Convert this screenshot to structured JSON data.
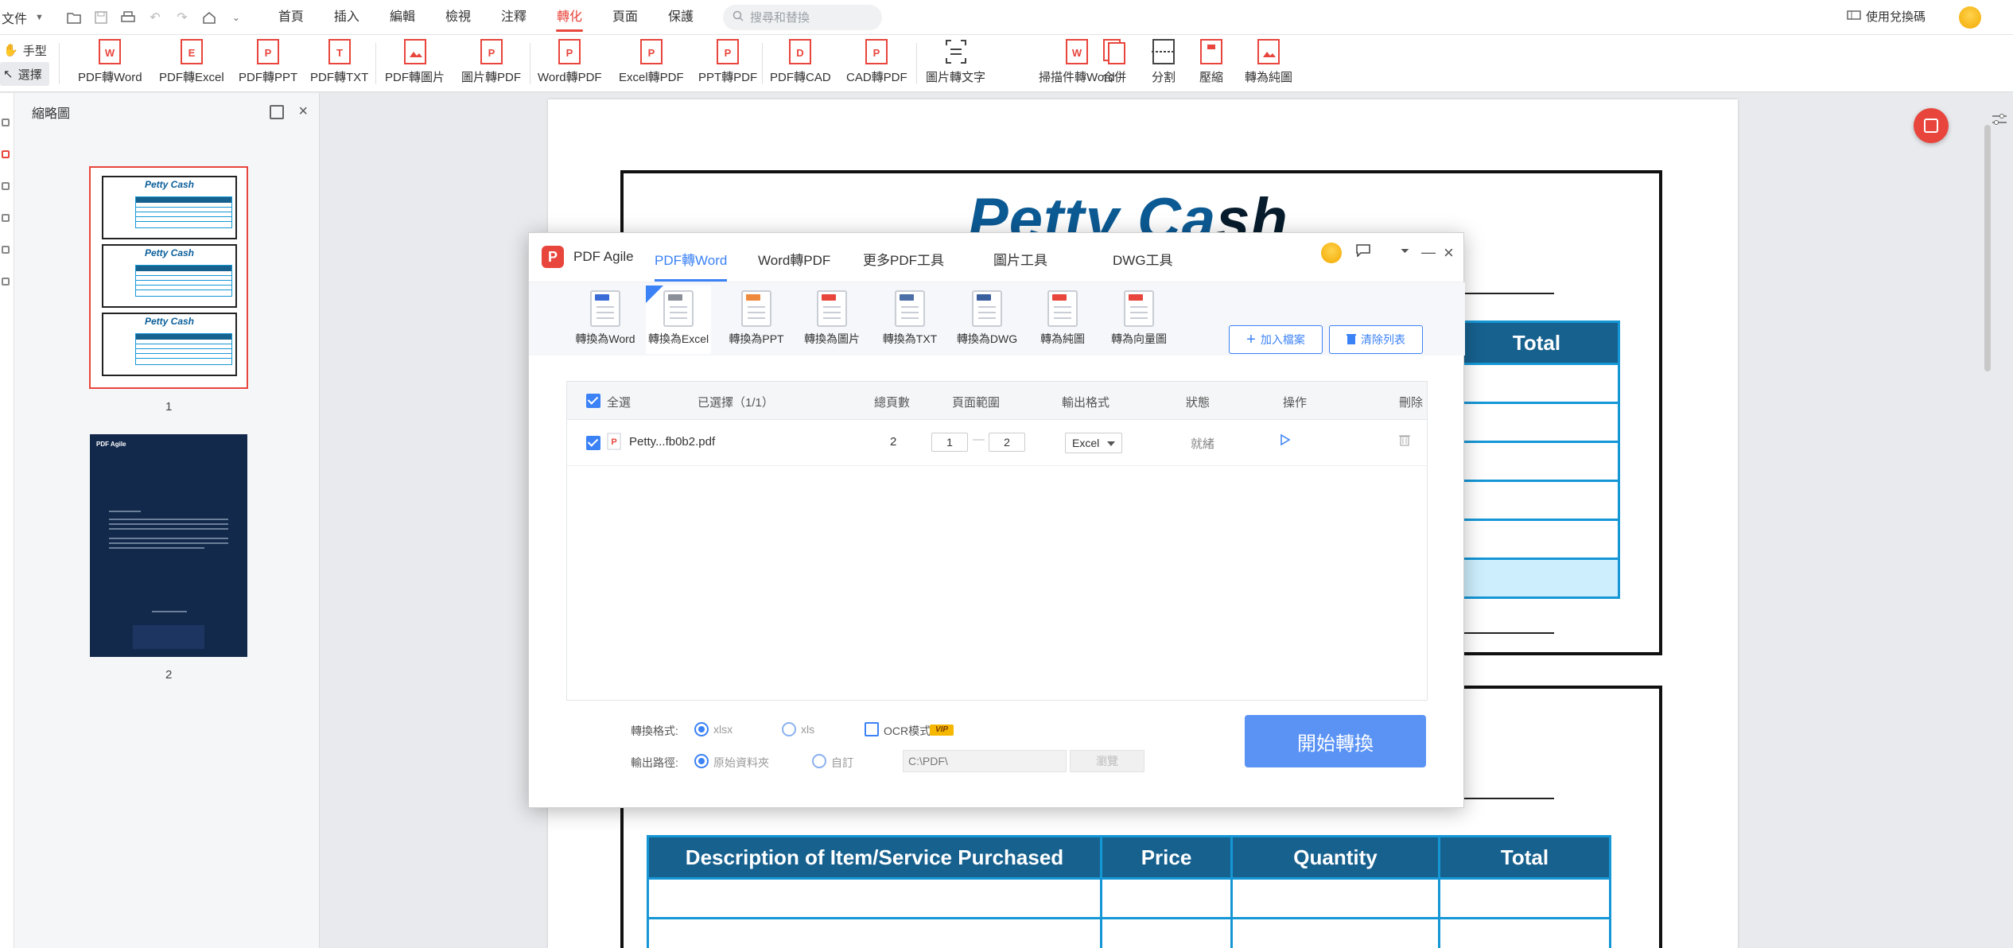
{
  "menubar": {
    "file": "文件",
    "tabs": [
      "首頁",
      "插入",
      "編輯",
      "檢視",
      "注釋",
      "轉化",
      "頁面",
      "保護"
    ],
    "active_tab": "轉化",
    "search_placeholder": "搜尋和替換",
    "redeem": "使用兌換碼"
  },
  "ribbon": {
    "hand": "手型",
    "select": "選擇",
    "tools": [
      "PDF轉Word",
      "PDF轉Excel",
      "PDF轉PPT",
      "PDF轉TXT",
      "PDF轉圖片",
      "圖片轉PDF",
      "Word轉PDF",
      "Excel轉PDF",
      "PPT轉PDF",
      "PDF轉CAD",
      "CAD轉PDF",
      "圖片轉文字",
      "掃描件轉Word",
      "合併",
      "分割",
      "壓縮",
      "轉為純圖"
    ]
  },
  "sidebar": {
    "title": "縮略圖",
    "thumb1_title": "Petty Cash",
    "page1": "1",
    "page2": "2",
    "thumb2_logo": "PDF Agile"
  },
  "document": {
    "title_a": "Petty Ca",
    "title_b": "sh",
    "table1_header": "Total",
    "table2_headers": [
      "Description of Item/Service Purchased",
      "Price",
      "Quantity",
      "Total"
    ]
  },
  "modal": {
    "app_name": "PDF Agile",
    "tabs": [
      "PDF轉Word",
      "Word轉PDF",
      "更多PDF工具",
      "圖片工具",
      "DWG工具"
    ],
    "active_tab": "PDF轉Word",
    "subtools": [
      "轉換為Word",
      "轉換為Excel",
      "轉換為PPT",
      "轉換為圖片",
      "轉換為TXT",
      "轉換為DWG",
      "轉為純圖",
      "轉為向量圖"
    ],
    "subtool_tags": [
      "DOCX",
      "XLSX",
      "PPTX",
      "JPG",
      "TXT",
      "DWG",
      "PDF",
      "PDF"
    ],
    "active_subtool": "轉換為Excel",
    "add_file": "加入檔案",
    "clear_list": "清除列表",
    "table": {
      "select_all": "全選",
      "selected": "已選擇（1/1）",
      "total_pages": "總頁數",
      "page_range": "頁面範圍",
      "output_format": "輸出格式",
      "status": "狀態",
      "action": "操作",
      "delete": "刪除"
    },
    "file_row": {
      "name": "Petty...fb0b2.pdf",
      "pages": "2",
      "from": "1",
      "to": "2",
      "format": "Excel",
      "status": "就緒"
    },
    "footer": {
      "convert_format_label": "轉換格式:",
      "opt_xlsx": "xlsx",
      "opt_xls": "xls",
      "ocr": "OCR模式",
      "vip": "VIP",
      "output_path_label": "輸出路徑:",
      "opt_original": "原始資料夾",
      "opt_custom": "自訂",
      "path_value": "C:\\PDF\\",
      "browse": "瀏覽",
      "start": "開始轉換"
    }
  },
  "colors": {
    "accent_red": "#e8453c",
    "accent_blue": "#3b82f6",
    "table_header": "#17618f",
    "table_border": "#1597d6"
  }
}
